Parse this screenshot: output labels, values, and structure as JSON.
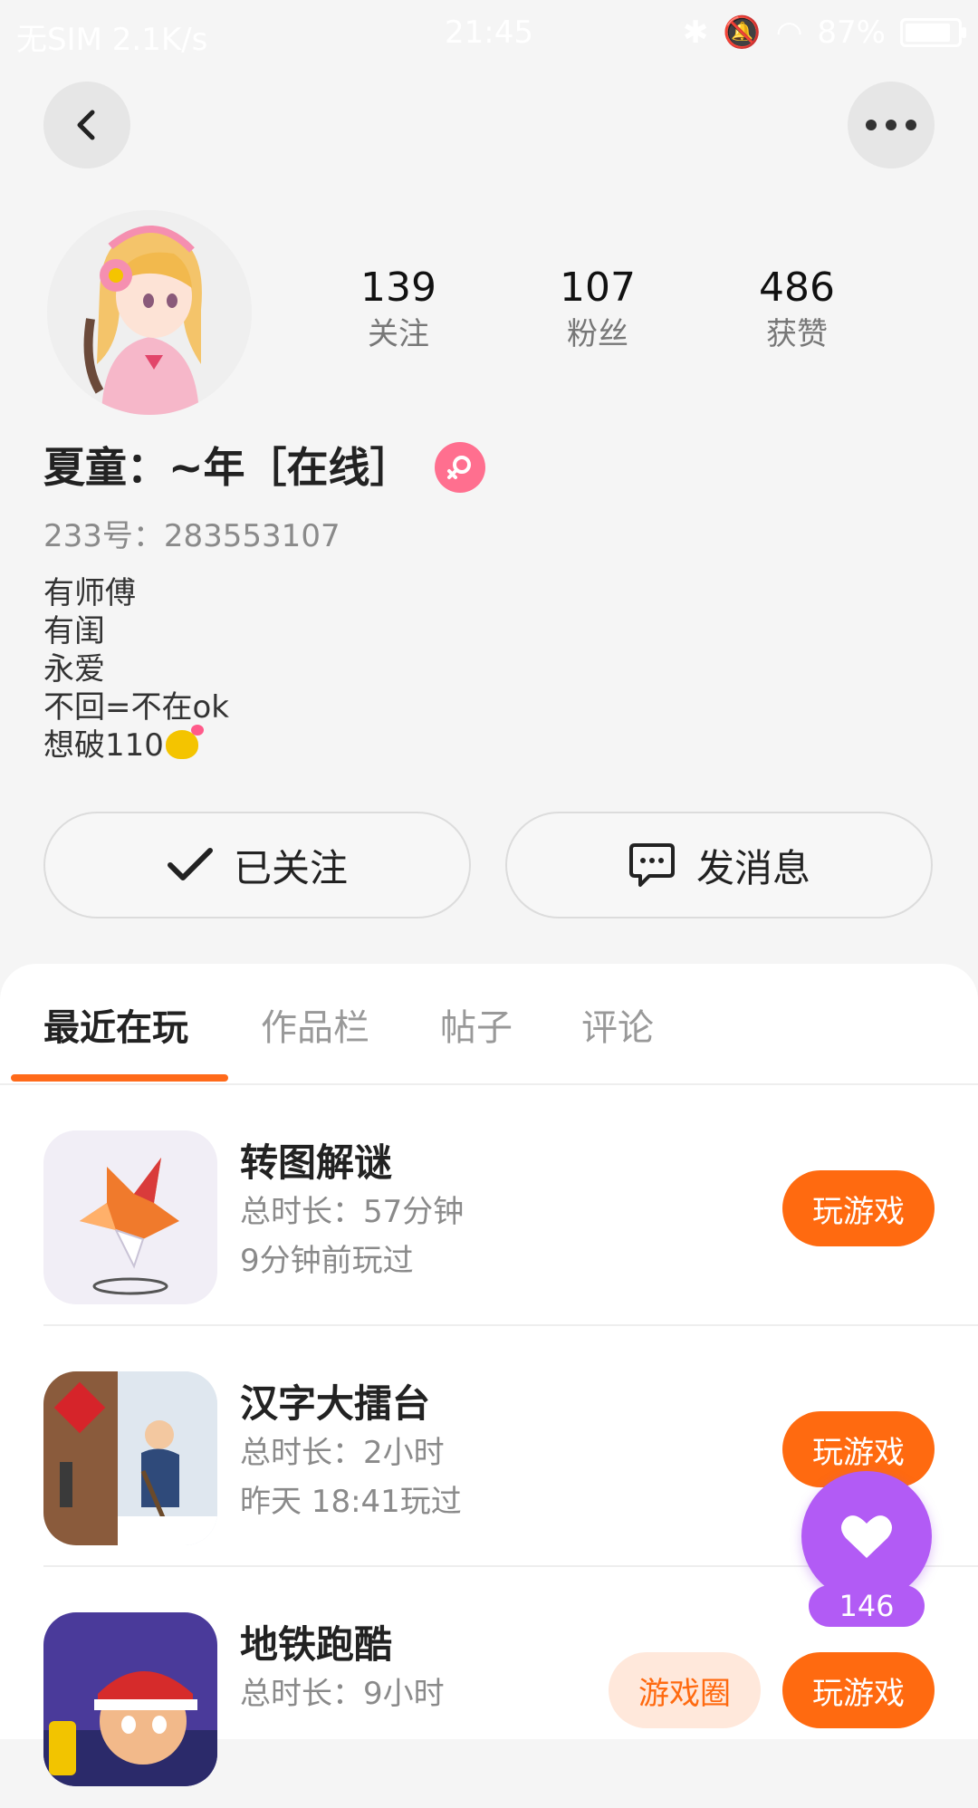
{
  "status_bar": {
    "carrier": "无SIM 2.1K/s",
    "time": "21:45",
    "battery": "87%",
    "battery_level": 0.87
  },
  "profile": {
    "stats": [
      {
        "value": "139",
        "label": "关注"
      },
      {
        "value": "107",
        "label": "粉丝"
      },
      {
        "value": "486",
        "label": "获赞"
      }
    ],
    "nickname": "夏童：~年［在线］",
    "gender_icon": "female-icon",
    "uid": "233号：283553107",
    "bio": [
      "有师傅",
      "有闺",
      "永爱",
      "不回=不在ok",
      "想破110"
    ]
  },
  "actions": {
    "follow_label": "已关注",
    "message_label": "发消息"
  },
  "tabs": [
    "最近在玩",
    "作品栏",
    "帖子",
    "评论"
  ],
  "active_tab": 0,
  "games": [
    {
      "name": "转图解谜",
      "duration": "总时长：57分钟",
      "last_played": "9分钟前玩过",
      "play_label": "玩游戏"
    },
    {
      "name": "汉字大擂台",
      "duration": "总时长：2小时",
      "last_played": "昨天 18:41玩过",
      "play_label": "玩游戏"
    },
    {
      "name": "地铁跑酷",
      "duration": "总时长：9小时",
      "circle_label": "游戏圈",
      "play_label": "玩游戏"
    }
  ],
  "like": {
    "count": "146"
  },
  "colors": {
    "accent": "#ff6a10",
    "like": "#b25bf5",
    "gender": "#ff6f8f"
  }
}
